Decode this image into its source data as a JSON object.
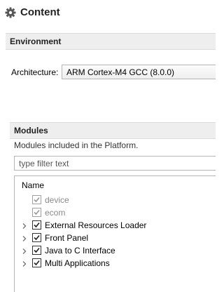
{
  "header": {
    "title": "Content",
    "icon": "gear-icon"
  },
  "environment": {
    "section_title": "Environment",
    "architecture_label": "Architecture:",
    "architecture_value": "ARM Cortex-M4 GCC (8.0.0)"
  },
  "modules": {
    "section_title": "Modules",
    "description": "Modules included in the Platform.",
    "filter_placeholder": "type filter text",
    "column_name": "Name",
    "items": [
      {
        "label": "device",
        "checked": true,
        "enabled": false,
        "expandable": false
      },
      {
        "label": "ecom",
        "checked": true,
        "enabled": false,
        "expandable": false
      },
      {
        "label": "External Resources Loader",
        "checked": true,
        "enabled": true,
        "expandable": true
      },
      {
        "label": "Front Panel",
        "checked": true,
        "enabled": true,
        "expandable": true
      },
      {
        "label": "Java to C Interface",
        "checked": true,
        "enabled": true,
        "expandable": true
      },
      {
        "label": "Multi Applications",
        "checked": true,
        "enabled": true,
        "expandable": true
      }
    ]
  }
}
